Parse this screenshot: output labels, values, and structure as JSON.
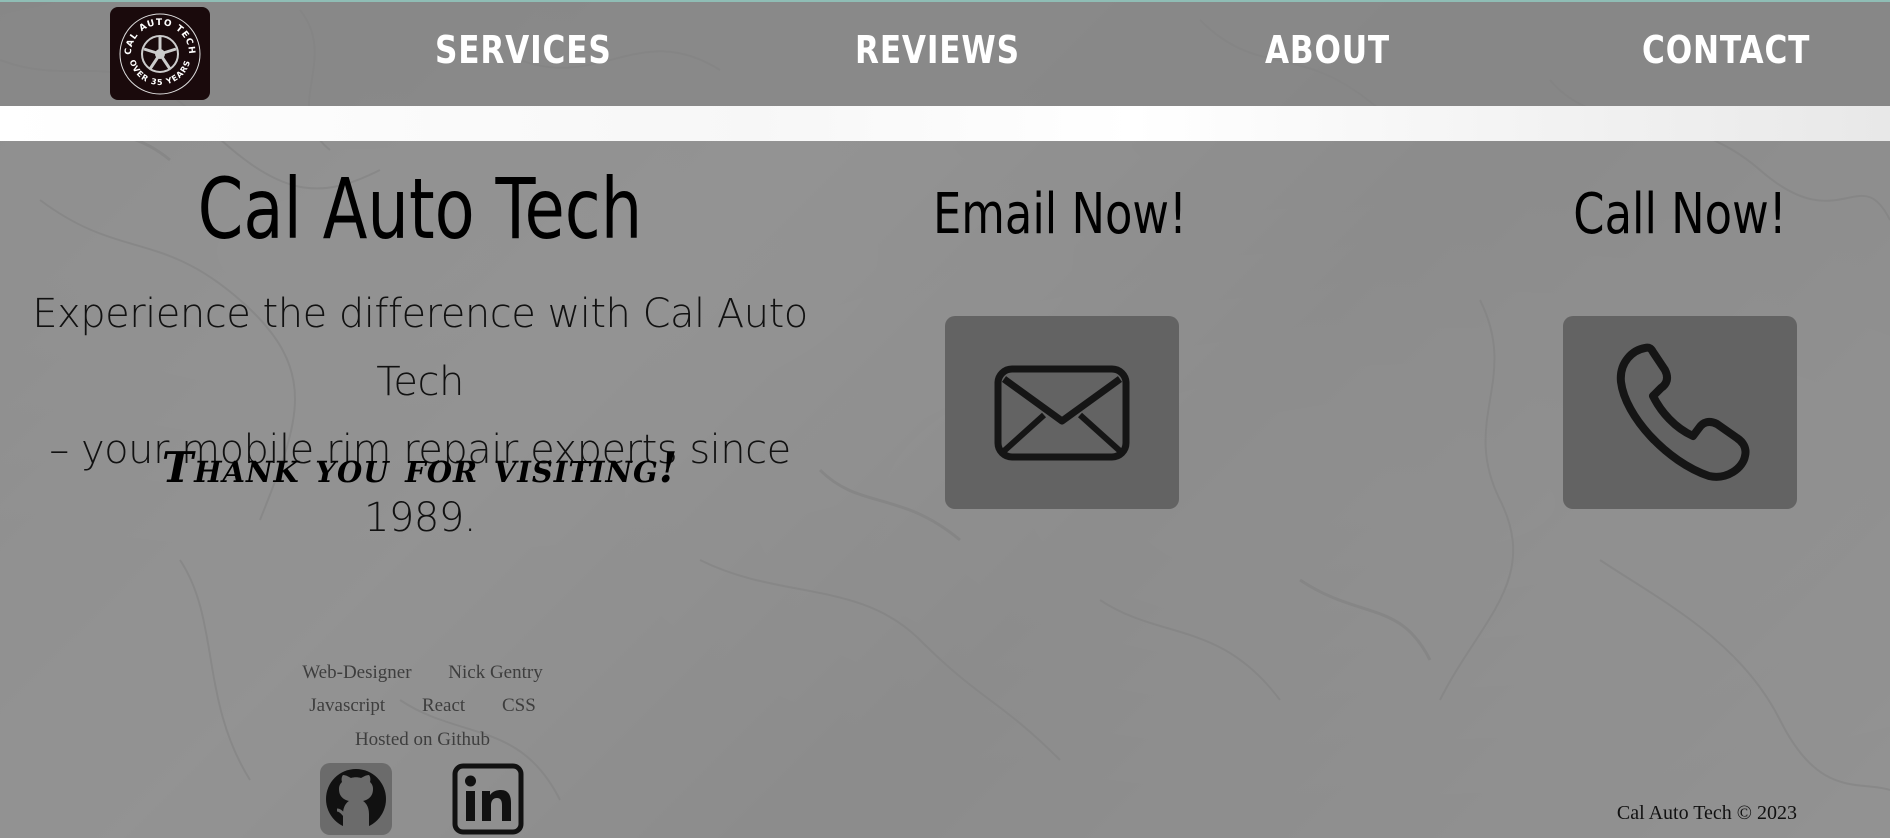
{
  "nav": {
    "logo_text_top": "CAL AUTO TECH",
    "logo_text_bottom": "OVER 35 YEARS",
    "items": [
      {
        "label": "SERVICES"
      },
      {
        "label": "REVIEWS"
      },
      {
        "label": "ABOUT"
      },
      {
        "label": "CONTACT"
      }
    ]
  },
  "hero": {
    "title": "Cal Auto Tech",
    "tagline_line1": "Experience the difference with Cal Auto Tech",
    "tagline_line2": "– your mobile rim repair experts since 1989.",
    "thanks": "Thank you for visiting!"
  },
  "contact": {
    "email_title": "Email Now!",
    "email_icon": "envelope-icon",
    "call_title": "Call Now!",
    "call_icon": "phone-icon"
  },
  "footer": {
    "designer_role": "Web-Designer",
    "designer_name": "Nick Gentry",
    "tech1": "Javascript",
    "tech2": "React",
    "tech3": "CSS",
    "hosting": "Hosted on Github",
    "social_icons": [
      "github-icon",
      "linkedin-icon"
    ],
    "copyright": "Cal Auto Tech © 2023"
  },
  "colors": {
    "nav_bg": "#808080",
    "panel_bg": "#787878",
    "cta_box": "#636363",
    "logo_bg": "#1a0a0c"
  }
}
